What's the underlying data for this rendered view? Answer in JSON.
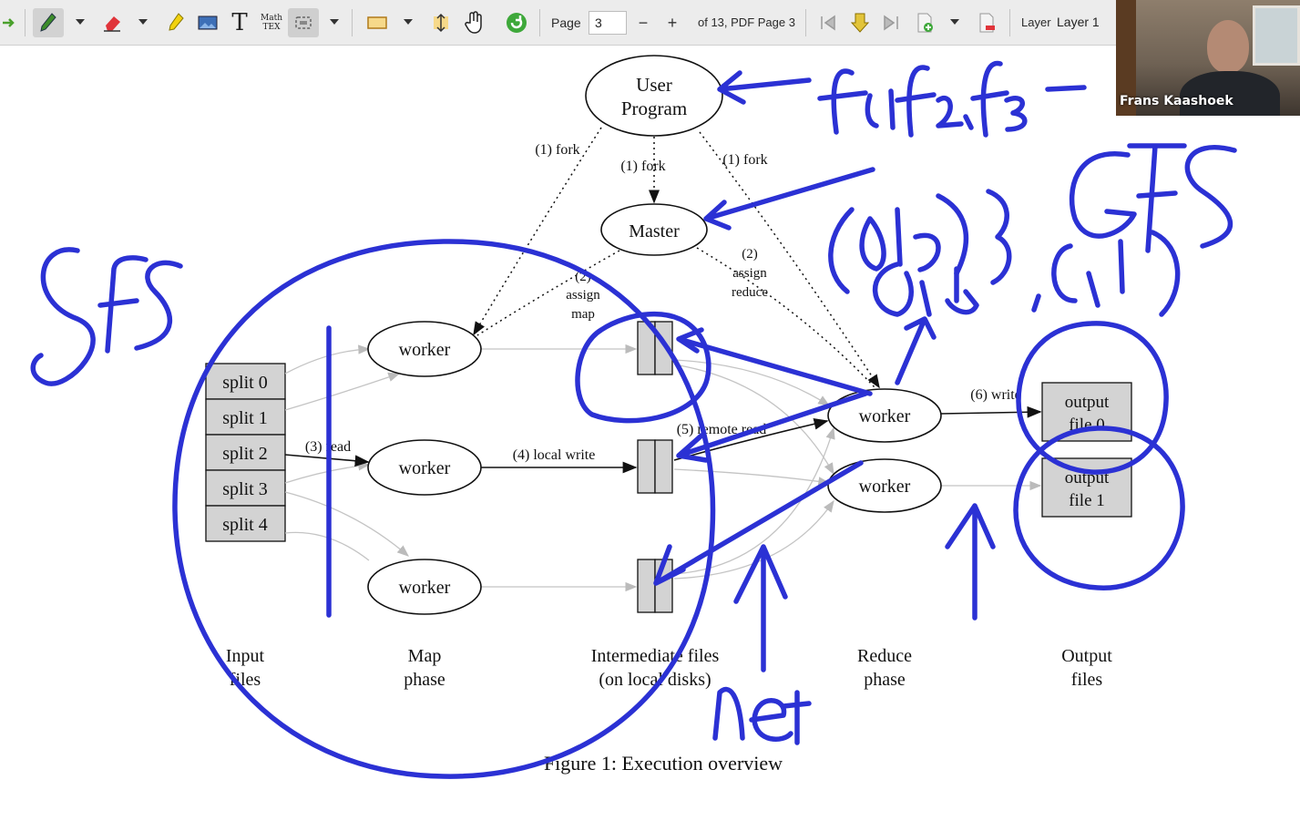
{
  "toolbar": {
    "page_label": "Page",
    "page_value": "3",
    "minus": "−",
    "plus": "+",
    "of_text": "of 13, PDF Page 3",
    "layer_label": "Layer",
    "layer_value": "Layer 1",
    "tools": [
      "redo-icon",
      "pen-icon",
      "eraser-icon",
      "highlighter-icon",
      "image-icon",
      "text-icon",
      "math-tex-icon",
      "select-object-icon",
      "rectangle-select-icon",
      "vertical-space-icon",
      "hand-icon",
      "refresh-icon",
      "first-page-icon",
      "goto-page-icon",
      "last-page-icon",
      "add-page-icon",
      "delete-page-icon"
    ],
    "math_icon_text_top": "Math",
    "math_icon_text_bottom": "TEX",
    "text_icon_glyph": "T"
  },
  "video": {
    "participant_name": "Frans Kaashoek"
  },
  "diagram": {
    "user_program_line1": "User",
    "user_program_line2": "Program",
    "master": "Master",
    "fork_left": "(1) fork",
    "fork_mid": "(1) fork",
    "fork_right": "(1) fork",
    "assign_map_1": "(2)",
    "assign_map_2": "assign",
    "assign_map_3": "map",
    "assign_reduce_1": "(2)",
    "assign_reduce_2": "assign",
    "assign_reduce_3": "reduce",
    "splits": [
      "split 0",
      "split 1",
      "split 2",
      "split 3",
      "split 4"
    ],
    "worker": "worker",
    "read": "(3) read",
    "local_write": "(4) local write",
    "remote_read": "(5) remote read",
    "write": "(6) write",
    "output_file0_l1": "output",
    "output_file0_l2": "file 0",
    "output_file1_l1": "output",
    "output_file1_l2": "file 1",
    "col_input_1": "Input",
    "col_input_2": "files",
    "col_map_1": "Map",
    "col_map_2": "phase",
    "col_inter_1": "Intermediate files",
    "col_inter_2": "(on local disks)",
    "col_reduce_1": "Reduce",
    "col_reduce_2": "phase",
    "col_output_1": "Output",
    "col_output_2": "files",
    "caption": "Figure 1: Execution overview"
  },
  "colors": {
    "ink": "#2b31d4",
    "toolbar_bg": "#ececec",
    "split_fill": "#d3d3d3"
  }
}
